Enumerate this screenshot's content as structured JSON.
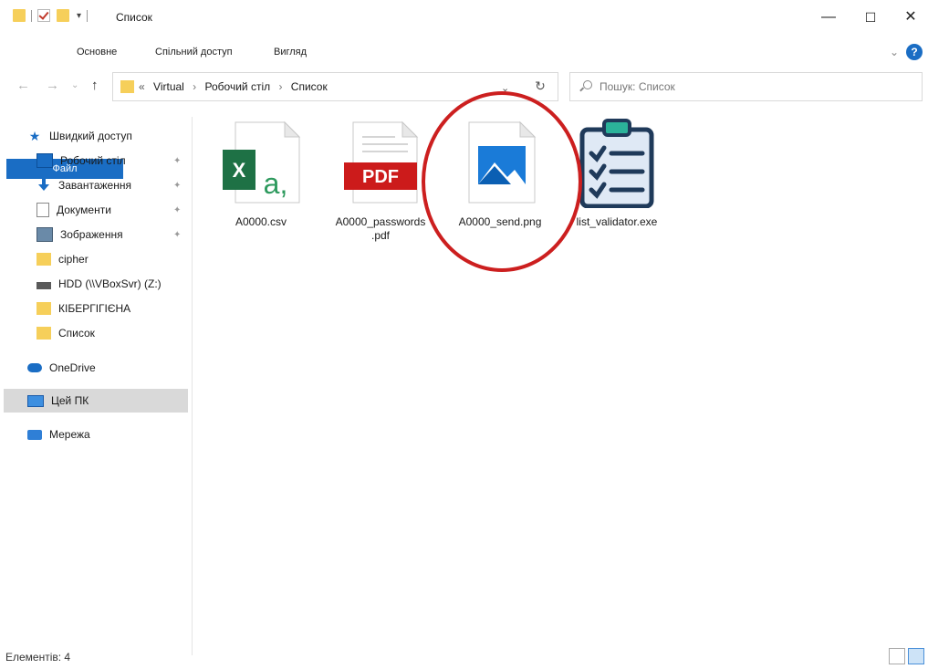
{
  "window": {
    "title": "Список",
    "minimize": "—",
    "maximize": "☐",
    "close": "✕"
  },
  "ribbon": {
    "tabs": [
      "Файл",
      "Основне",
      "Спільний доступ",
      "Вигляд"
    ],
    "expand": "⌄",
    "help": "?"
  },
  "nav": {
    "back": "←",
    "forward": "→",
    "recent": "⌄",
    "up": "↑",
    "path": [
      "«",
      "Virtual",
      "›",
      "Робочий стіл",
      "›",
      "Список"
    ],
    "dropdown": "⌄",
    "refresh": "↻",
    "search_placeholder": "Пошук: Список"
  },
  "sidebar": {
    "items": [
      {
        "label": "Швидкий доступ",
        "icon": "star-icon"
      },
      {
        "label": "Робочий стіл",
        "icon": "desktop-icon",
        "pinned": true
      },
      {
        "label": "Завантаження",
        "icon": "download-icon",
        "pinned": true
      },
      {
        "label": "Документи",
        "icon": "documents-icon",
        "pinned": true
      },
      {
        "label": "Зображення",
        "icon": "pictures-icon",
        "pinned": true
      },
      {
        "label": "cipher",
        "icon": "folder-icon"
      },
      {
        "label": "HDD (\\\\VBoxSvr) (Z:)",
        "icon": "network-drive-icon"
      },
      {
        "label": "КІБЕРГІГІЄНА",
        "icon": "folder-icon"
      },
      {
        "label": "Список",
        "icon": "folder-icon"
      },
      {
        "label": "OneDrive",
        "icon": "cloud-icon"
      },
      {
        "label": "Цей ПК",
        "icon": "pc-icon",
        "selected": true
      },
      {
        "label": "Мережа",
        "icon": "network-icon"
      }
    ],
    "pin_glyph": "📌"
  },
  "files": [
    {
      "name": "A0000.csv",
      "icon": "excel-csv-icon",
      "excel_letter": "X",
      "csv_letter": "a,"
    },
    {
      "name": "A0000_passwords\n.pdf",
      "icon": "pdf-icon",
      "pdf_text": "PDF"
    },
    {
      "name": "A0000_send.png",
      "icon": "image-icon",
      "highlighted": true
    },
    {
      "name": "list_validator.exe",
      "icon": "checklist-icon"
    }
  ],
  "status": {
    "count": "Елементів: 4"
  },
  "colors": {
    "accent": "#1a6dc4",
    "highlight_circle": "#cc1f1f",
    "folder": "#f6cf5a"
  }
}
